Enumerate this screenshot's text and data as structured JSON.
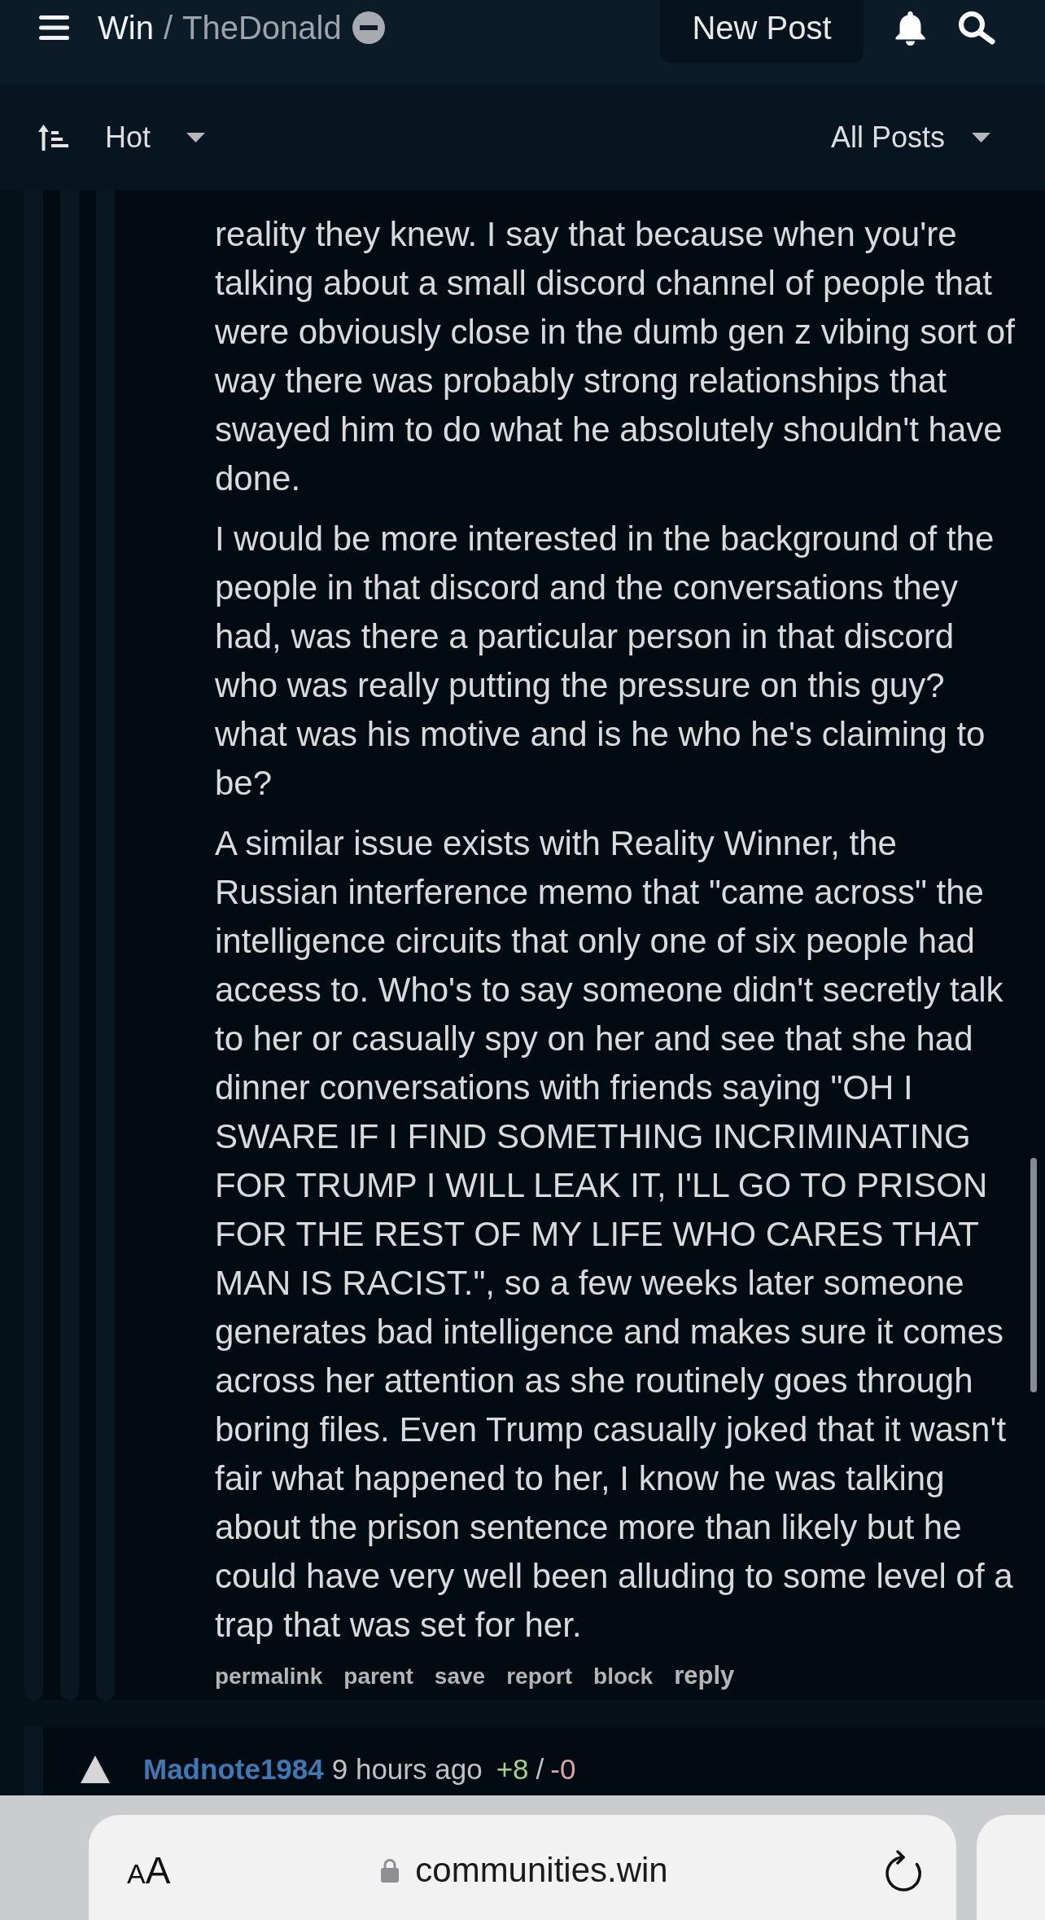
{
  "header": {
    "site": "Win",
    "separator": "/",
    "community": "TheDonald",
    "new_post_button": "New Post"
  },
  "sort_bar": {
    "sort": "Hot",
    "filter": "All Posts"
  },
  "comments": [
    {
      "children": [
        {
          "children": [
            {
              "paragraphs": [
                "reality they knew. I say that because when you're talking about a small discord channel of people that were obviously close in the dumb gen z vibing sort of way there was probably strong relationships that swayed him to do what he absolutely shouldn't have done.",
                "I would be more interested in the background of the people in that discord and the conversations they had, was there a particular person in that discord who was really putting the pressure on this guy? what was his motive and is he who he's claiming to be?",
                "A similar issue exists with Reality Winner, the Russian interference memo that \"came across\" the intelligence circuits that only one of six people had access to. Who's to say someone didn't secretly talk to her or casually spy on her and see that she had dinner conversations with friends saying \"OH I SWARE IF I FIND SOMETHING INCRIMINATING FOR TRUMP I WILL LEAK IT, I'LL GO TO PRISON FOR THE REST OF MY LIFE WHO CARES THAT MAN IS RACIST.\", so a few weeks later someone generates bad intelligence and makes sure it comes across her attention as she routinely goes through boring files. Even Trump casually joked that it wasn't fair what happened to her, I know he was talking about the prison sentence more than likely but he could have very well been alluding to some level of a trap that was set for her."
              ],
              "actions": [
                {
                  "label": "permalink",
                  "kind": "link"
                },
                {
                  "label": "parent",
                  "kind": "link"
                },
                {
                  "label": "save",
                  "kind": "link"
                },
                {
                  "label": "report",
                  "kind": "link"
                },
                {
                  "label": "block",
                  "kind": "link"
                },
                {
                  "label": "reply",
                  "kind": "primary"
                }
              ]
            }
          ]
        }
      ]
    },
    {
      "author": "Madnote1984",
      "time": "9 hours ago",
      "upvotes": "+8",
      "vote_separator": "/",
      "downvotes": "-0"
    }
  ],
  "browser_bar": {
    "text_size_button": "AA",
    "url": "communities.win"
  }
}
